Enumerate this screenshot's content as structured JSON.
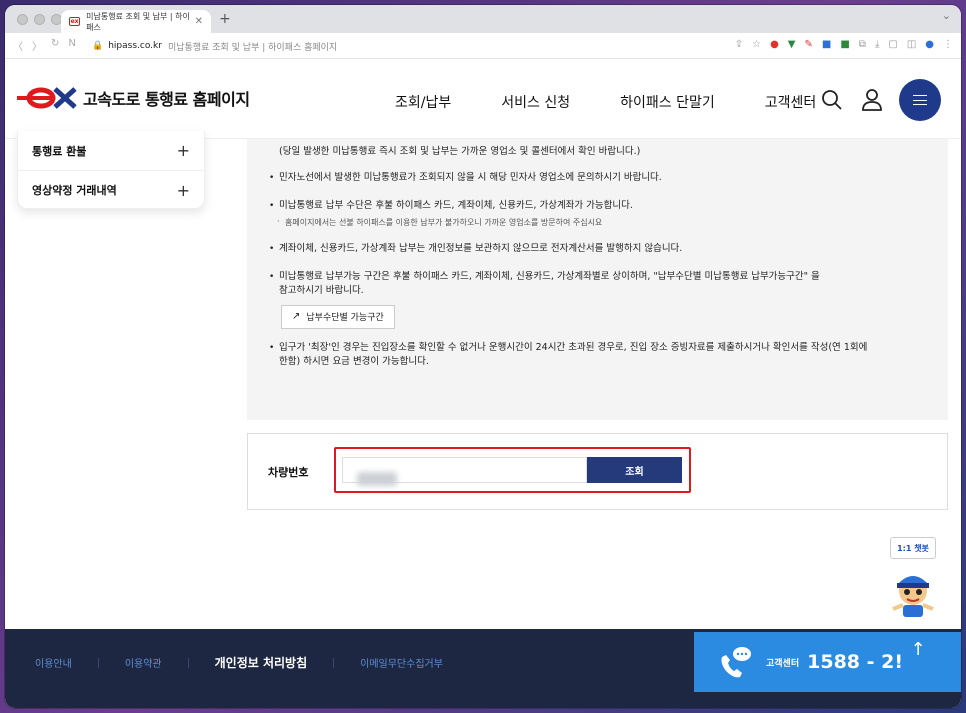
{
  "browser": {
    "tab_title": "미납통행료 조회 및 납부 | 하이패스 ",
    "tab_favicon": "ex",
    "url_host": "hipass.co.kr",
    "url_title": "미납통행료 조회 및 납부 | 하이패스 홈페이지"
  },
  "header": {
    "logo_text": "고속도로 통행료 홈페이지",
    "nav": [
      "조회/납부",
      "서비스 신청",
      "하이패스 단말기",
      "고객센터"
    ]
  },
  "sidebar": {
    "items": [
      {
        "label": "통행료 환불"
      },
      {
        "label": "영상약정 거래내역"
      }
    ]
  },
  "notice": {
    "line0": "(당일 발생한 미납통행료 즉시 조회 및 납부는 가까운 영업소 및 콜센터에서 확인 바랍니다.)",
    "b1": "민자노선에서 발생한 미납통행료가 조회되지 않을 시 해당 민자사 영업소에 문의하시기 바랍니다.",
    "b2": "미납통행료 납부 수단은 후불 하이패스 카드, 계좌이체, 신용카드, 가상계좌가 가능합니다.",
    "b2_sub": "홈페이지에서는 선불 하이패스를 이용한 납부가 불가하오니 가까운 영업소를 방문하여 주십시요",
    "b3": "계좌이체, 신용카드, 가상계좌 납부는 개인정보를 보관하지 않으므로 전자계산서를 발행하지 않습니다.",
    "b4a": "미납통행료 납부가능 구간은 후불 하이패스 카드, 계좌이체, 신용카드, 가상계좌별로 상이하며, \"납부수단별 미납통행료 납부가능구간\" 을",
    "b4b": "참고하시기 바랍니다.",
    "link_button": "납부수단별 가능구간",
    "b5a": "입구가 '최장'인 경우는 진입장소를 확인할 수 없거나 운행시간이 24시간 초과된 경우로, 진입 장소 증빙자료를 제출하시거나 확인서를 작성(연 1회에",
    "b5b": "한함) 하시면 요금 변경이 가능합니다."
  },
  "search": {
    "label": "차량번호",
    "input_value": "",
    "button": "조회"
  },
  "floating": {
    "chatbot": "1:1 챗봇"
  },
  "footer": {
    "links": [
      "이용안내",
      "이용약관",
      "개인정보 처리방침",
      "이메일무단수집거부"
    ],
    "cs_label": "고객센터",
    "cs_phone": "1588 - 2!"
  },
  "colors": {
    "brand_blue": "#243a7a",
    "highlight_red": "#e0191e",
    "footer_bg": "#1d2742",
    "cs_blue": "#2a8be0"
  }
}
